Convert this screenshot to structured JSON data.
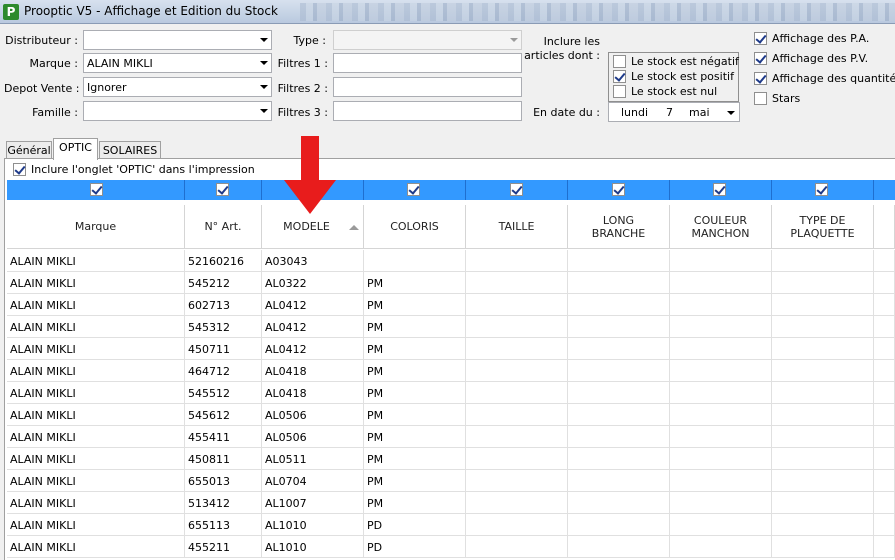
{
  "window": {
    "title": "Prooptic V5 - Affichage et Edition du Stock",
    "app_icon": "P"
  },
  "filters": {
    "distributeur_label": "Distributeur :",
    "distributeur_value": "",
    "marque_label": "Marque :",
    "marque_value": "ALAIN MIKLI",
    "depot_label": "Depot Vente :",
    "depot_value": "Ignorer",
    "famille_label": "Famille :",
    "famille_value": "",
    "type_label": "Type :",
    "type_value": "",
    "filtre1_label": "Filtres 1 :",
    "filtre2_label": "Filtres 2 :",
    "filtre3_label": "Filtres 3 :",
    "inclure_label_1": "Inclure les",
    "inclure_label_2": "articles dont :",
    "stock_negatif": {
      "label": "Le stock est négatif",
      "checked": false
    },
    "stock_positif": {
      "label": "Le stock est positif",
      "checked": true
    },
    "stock_nul": {
      "label": "Le stock est nul",
      "checked": false
    },
    "date_label": "En date du :",
    "date_day_name": "lundi",
    "date_day": "7",
    "date_month": "mai"
  },
  "display_options": {
    "pa": {
      "label": "Affichage des P.A.",
      "checked": true
    },
    "pv": {
      "label": "Affichage des P.V.",
      "checked": true
    },
    "qte": {
      "label": "Affichage des quantités",
      "checked": true
    },
    "stars": {
      "label": "Stars",
      "checked": false
    }
  },
  "tabs": [
    {
      "label": "Général",
      "active": false
    },
    {
      "label": "OPTIC",
      "active": true
    },
    {
      "label": "SOLAIRES",
      "active": false
    }
  ],
  "print_option": {
    "label": "Inclure l'onglet 'OPTIC' dans l'impression",
    "checked": true
  },
  "colors": {
    "selection_bar": "#3399ff",
    "arrow": "#e81c1c"
  },
  "table": {
    "columns": [
      {
        "label_1": "Marque",
        "label_2": ""
      },
      {
        "label_1": "N° Art.",
        "label_2": ""
      },
      {
        "label_1": "MODELE",
        "label_2": "",
        "sorted": true
      },
      {
        "label_1": "COLORIS",
        "label_2": ""
      },
      {
        "label_1": "TAILLE",
        "label_2": ""
      },
      {
        "label_1": "LONG",
        "label_2": "BRANCHE"
      },
      {
        "label_1": "COULEUR",
        "label_2": "MANCHON"
      },
      {
        "label_1": "TYPE DE",
        "label_2": "PLAQUETTE"
      }
    ],
    "rows": [
      [
        "ALAIN MIKLI",
        "52160216",
        "A03043",
        ""
      ],
      [
        "ALAIN MIKLI",
        "545212",
        "AL0322",
        "PM"
      ],
      [
        "ALAIN MIKLI",
        "602713",
        "AL0412",
        "PM"
      ],
      [
        "ALAIN MIKLI",
        "545312",
        "AL0412",
        "PM"
      ],
      [
        "ALAIN MIKLI",
        "450711",
        "AL0412",
        "PM"
      ],
      [
        "ALAIN MIKLI",
        "464712",
        "AL0418",
        "PM"
      ],
      [
        "ALAIN MIKLI",
        "545512",
        "AL0418",
        "PM"
      ],
      [
        "ALAIN MIKLI",
        "545612",
        "AL0506",
        "PM"
      ],
      [
        "ALAIN MIKLI",
        "455411",
        "AL0506",
        "PM"
      ],
      [
        "ALAIN MIKLI",
        "450811",
        "AL0511",
        "PM"
      ],
      [
        "ALAIN MIKLI",
        "655013",
        "AL0704",
        "PM"
      ],
      [
        "ALAIN MIKLI",
        "513412",
        "AL1007",
        "PM"
      ],
      [
        "ALAIN MIKLI",
        "655113",
        "AL1010",
        "PD"
      ],
      [
        "ALAIN MIKLI",
        "455211",
        "AL1010",
        "PD"
      ]
    ]
  }
}
